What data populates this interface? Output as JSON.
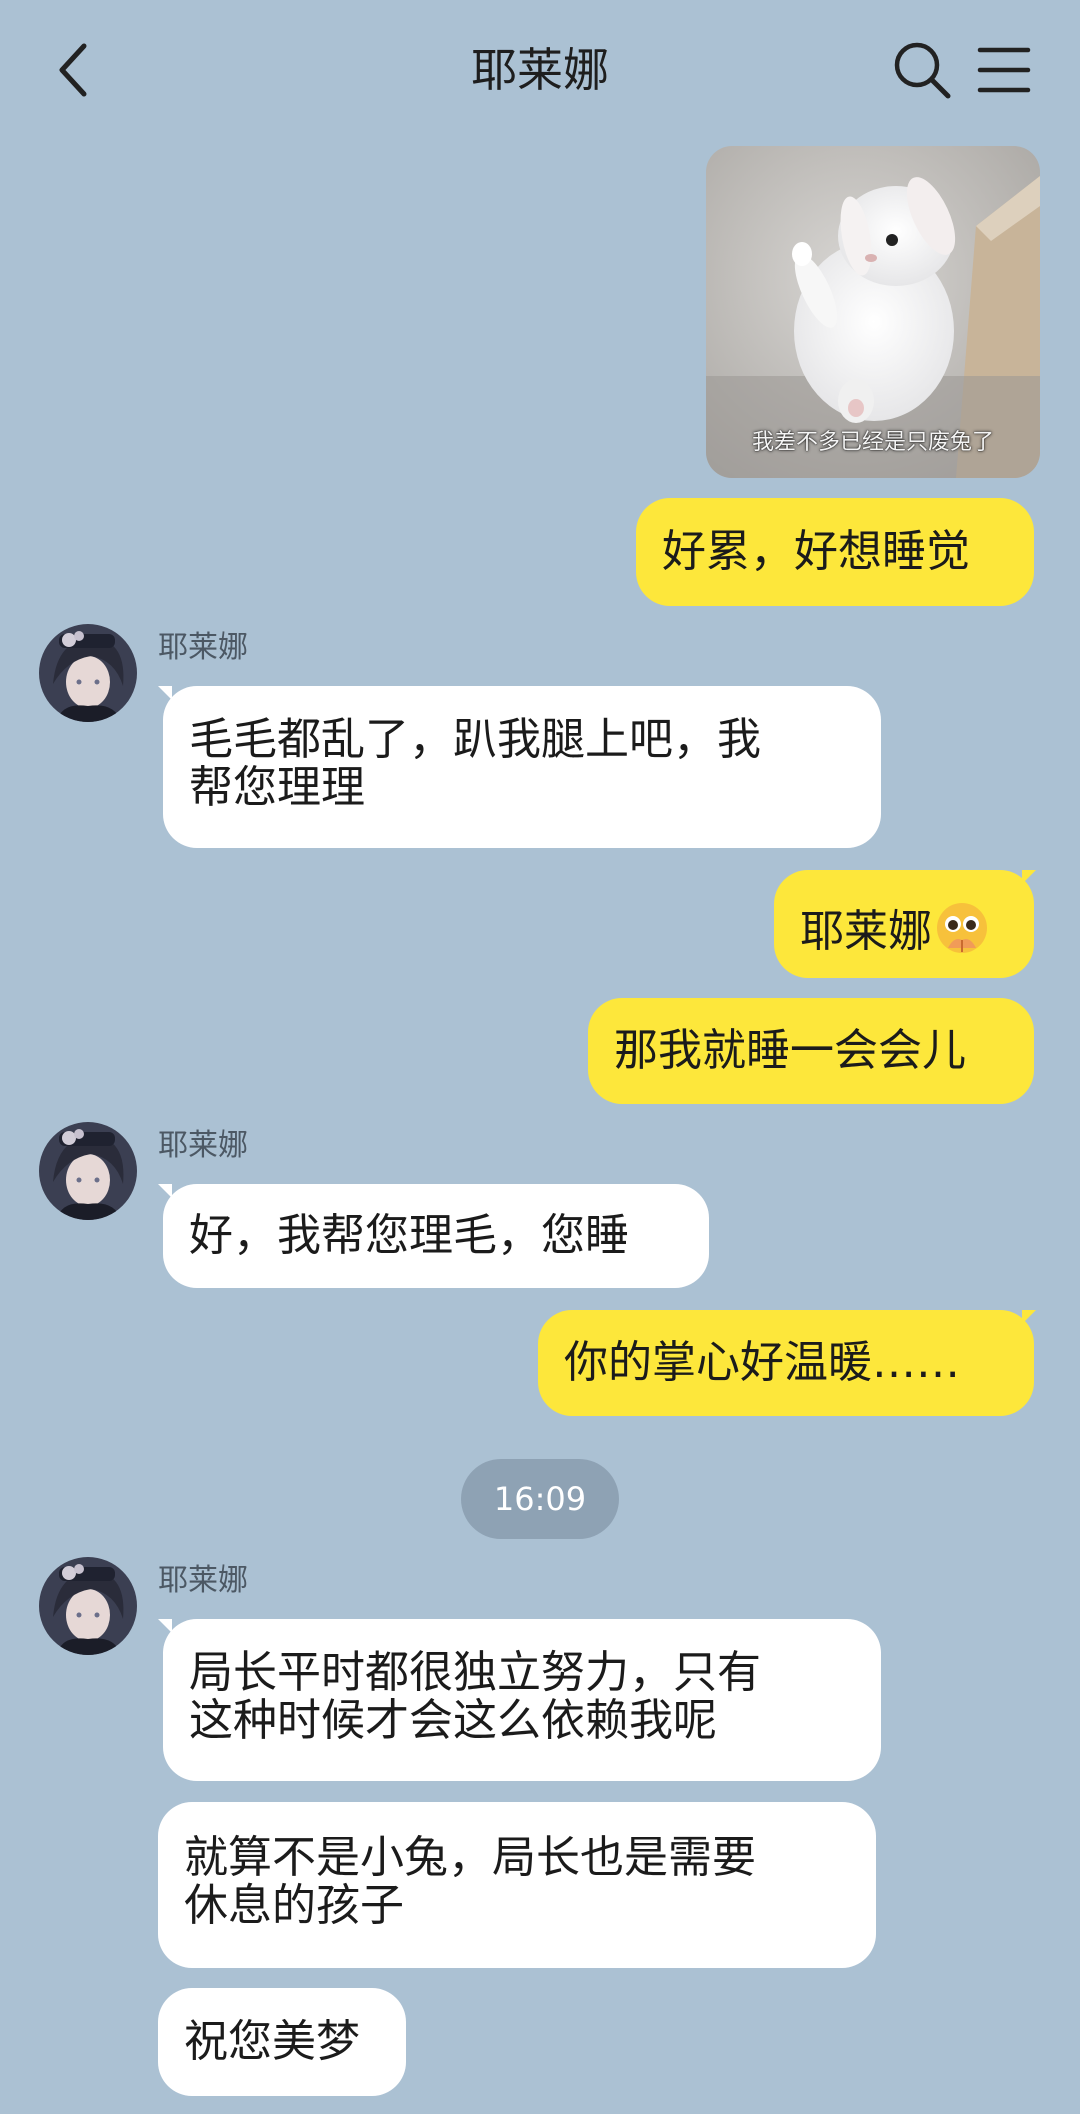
{
  "header": {
    "title": "耶莱娜"
  },
  "photo": {
    "caption": "我差不多已经是只废兔了"
  },
  "contact": {
    "name": "耶莱娜"
  },
  "messages": {
    "m1": "好累，好想睡觉",
    "m2_line1": "毛毛都乱了，趴我腿上吧，我",
    "m2_line2": "帮您理理",
    "m3": "耶莱娜",
    "m4": "那我就睡一会会儿",
    "m5": "好，我帮您理毛，您睡",
    "m6": "你的掌心好温暖……",
    "m7_line1": "局长平时都很独立努力，只有",
    "m7_line2": "这种时候才会这么依赖我呢",
    "m8_line1": "就算不是小兔，局长也是需要",
    "m8_line2": "休息的孩子",
    "m9": "祝您美梦"
  },
  "timestamp": "16:09",
  "icons": {
    "back": "back-arrow-icon",
    "search": "search-icon",
    "menu": "menu-icon",
    "emoji": "pleading-face-emoji"
  },
  "colors": {
    "background": "#abc1d3",
    "my_bubble": "#fde73b",
    "their_bubble": "#ffffff",
    "time_pill": "#8ea2b4"
  }
}
